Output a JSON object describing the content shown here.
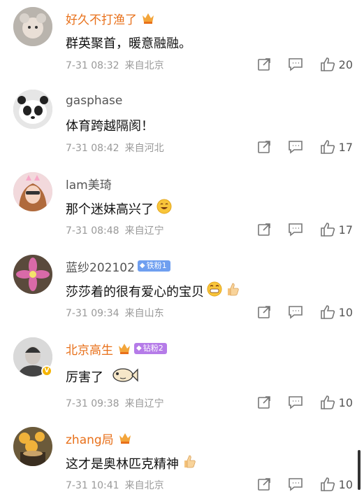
{
  "comments": [
    {
      "username": "好久不打渔了",
      "name_color": "#e8701a",
      "text": "群英聚首，暖意融融。",
      "time": "7-31 08:32",
      "location": "来自北京",
      "likes": "20"
    },
    {
      "username": "gasphase",
      "name_color": "#555555",
      "text": "体育跨越隔阂！",
      "time": "7-31 08:42",
      "location": "来自河北",
      "likes": "17"
    },
    {
      "username": "lam美琦",
      "name_color": "#555555",
      "text": "那个迷妹高兴了",
      "time": "7-31 08:48",
      "location": "来自辽宁",
      "likes": "17"
    },
    {
      "username": "蓝纱202102",
      "name_color": "#555555",
      "fan_badge": "铁粉1",
      "text": "莎莎着的很有爱心的宝贝",
      "time": "7-31 09:34",
      "location": "来自山东",
      "likes": "10"
    },
    {
      "username": "北京高生",
      "name_color": "#e8701a",
      "fan_badge": "钻粉2",
      "text": "厉害了",
      "time": "7-31 09:38",
      "location": "来自辽宁",
      "likes": "10"
    },
    {
      "username": "zhang局",
      "name_color": "#e8701a",
      "text": "这才是奥林匹克精神",
      "time": "7-31 10:41",
      "location": "来自北京",
      "likes": "10"
    }
  ],
  "icons": {
    "share": "share-icon",
    "comment": "comment-icon",
    "like": "like-icon",
    "vip": "crown-icon"
  }
}
